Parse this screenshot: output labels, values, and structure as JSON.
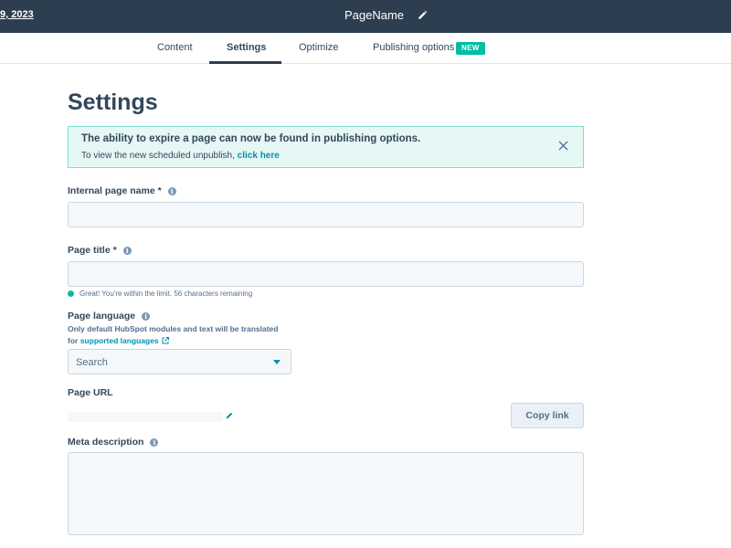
{
  "topbar": {
    "date_text": "9, 2023",
    "page_name": "PageName"
  },
  "tabs": [
    {
      "label": "Content"
    },
    {
      "label": "Settings"
    },
    {
      "label": "Optimize"
    },
    {
      "label": "Publishing options"
    }
  ],
  "badge_new": "NEW",
  "heading": "Settings",
  "alert": {
    "title": "The ability to expire a page can now be found in publishing options.",
    "body_prefix": "To view the new scheduled unpublish, ",
    "link_text": "click here"
  },
  "fields": {
    "internal_name_label": "Internal page name *",
    "page_title_label": "Page title *",
    "title_hint": "Great! You're within the limit. 56 characters remaining",
    "language_label": "Page language",
    "language_help_line1": "Only default HubSpot modules and text will be translated",
    "language_help_prefix": "for ",
    "language_help_link": "supported languages",
    "language_select_placeholder": "Search",
    "url_label": "Page URL",
    "copy_link": "Copy link",
    "meta_label": "Meta description"
  },
  "colors": {
    "topbar": "#2d3e50",
    "accent": "#0091ae",
    "success": "#00bda5",
    "alert_bg": "#e5f8f6"
  },
  "icons": {
    "pencil": "pencil-icon",
    "close": "close-icon",
    "info": "info-icon",
    "external_link": "external-link-icon",
    "caret": "caret-down-icon"
  }
}
